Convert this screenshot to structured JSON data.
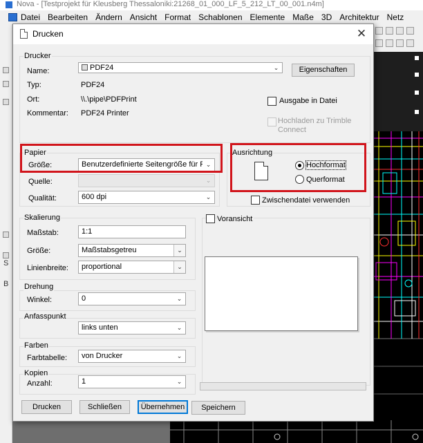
{
  "app": {
    "title": "Nova - [Testprojekt für Kleusberg Thessaloniki:21268_01_000_LF_5_212_LT_00_001.n4m]",
    "menu": [
      "Datei",
      "Bearbeiten",
      "Ändern",
      "Ansicht",
      "Format",
      "Schablonen",
      "Elemente",
      "Maße",
      "3D",
      "Architektur",
      "Netz"
    ],
    "left_tool_letters": [
      "S",
      "B"
    ]
  },
  "dialog": {
    "title": "Drucken",
    "close_glyph": "✕",
    "printer": {
      "group_label": "Drucker",
      "name_label": "Name:",
      "name_value": "PDF24",
      "properties_button": "Eigenschaften",
      "type_label": "Typ:",
      "type_value": "PDF24",
      "location_label": "Ort:",
      "location_value": "\\\\.\\pipe\\PDFPrint",
      "comment_label": "Kommentar:",
      "comment_value": "PDF24 Printer",
      "print_to_file": "Ausgabe in Datei",
      "upload_trimble": "Hochladen zu Trimble Connect"
    },
    "paper": {
      "group_label": "Papier",
      "size_label": "Größe:",
      "size_value": "Benutzerdefinierte Seitengröße für Pos",
      "source_label": "Quelle:",
      "source_value": "",
      "quality_label": "Qualität:",
      "quality_value": "600 dpi"
    },
    "orientation": {
      "group_label": "Ausrichtung",
      "portrait": "Hochformat",
      "landscape": "Querformat",
      "selected": "portrait"
    },
    "temp_file": "Zwischendatei verwenden",
    "preview": "Voransicht",
    "scaling": {
      "group_label": "Skalierung",
      "scale_label": "Maßstab:",
      "scale_value": "1:1",
      "size_label": "Größe:",
      "size_value": "Maßstabsgetreu",
      "linewidth_label": "Linienbreite:",
      "linewidth_value": "proportional"
    },
    "rotation": {
      "group_label": "Drehung",
      "angle_label": "Winkel:",
      "angle_value": "0"
    },
    "anchor": {
      "group_label": "Anfasspunkt",
      "value": "links unten"
    },
    "colors": {
      "group_label": "Farben",
      "table_label": "Farbtabelle:",
      "table_value": "von Drucker"
    },
    "copies": {
      "group_label": "Kopien",
      "count_label": "Anzahl:",
      "count_value": "1"
    },
    "buttons": {
      "print": "Drucken",
      "close": "Schließen",
      "apply": "Übernehmen",
      "save": "Speichern"
    }
  }
}
